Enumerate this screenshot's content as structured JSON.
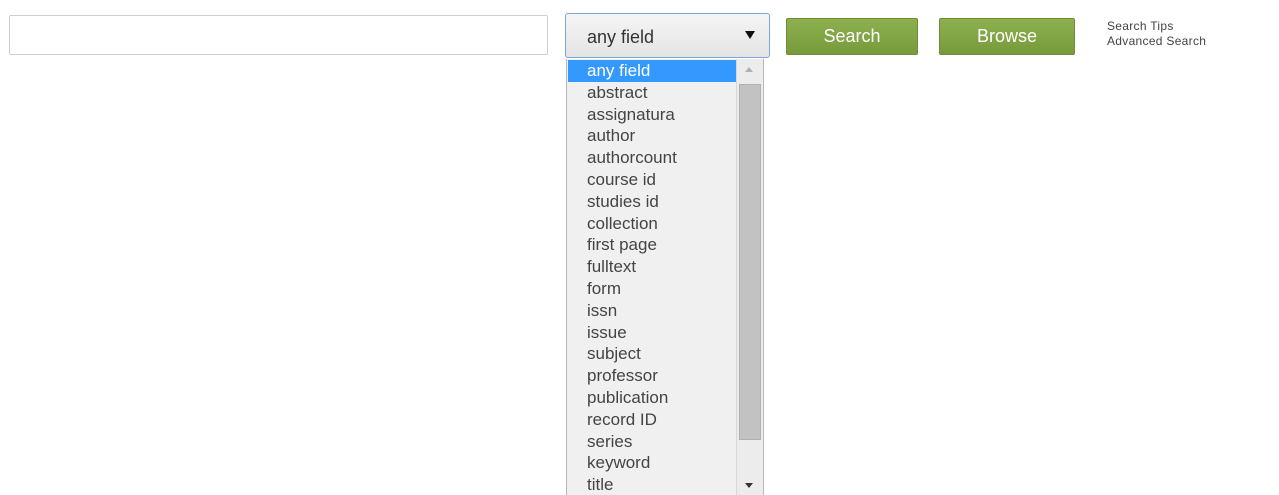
{
  "search": {
    "value": "",
    "placeholder": ""
  },
  "field_select": {
    "selected": "any field",
    "options": [
      "any field",
      "abstract",
      "assignatura",
      "author",
      "authorcount",
      "course id",
      "studies id",
      "collection",
      "first page",
      "fulltext",
      "form",
      "issn",
      "issue",
      "subject",
      "professor",
      "publication",
      "record ID",
      "series",
      "keyword",
      "title"
    ]
  },
  "buttons": {
    "search_label": "Search",
    "browse_label": "Browse"
  },
  "links": {
    "search_tips": "Search Tips",
    "advanced_search": "Advanced Search"
  },
  "colors": {
    "button_green": "#8db04f",
    "selected_option": "#3399ff",
    "select_border": "#7aa7d6"
  },
  "icons": {
    "select_caret": "caret-down-icon",
    "scroll_up": "scroll-up-icon",
    "scroll_down": "scroll-down-icon"
  }
}
